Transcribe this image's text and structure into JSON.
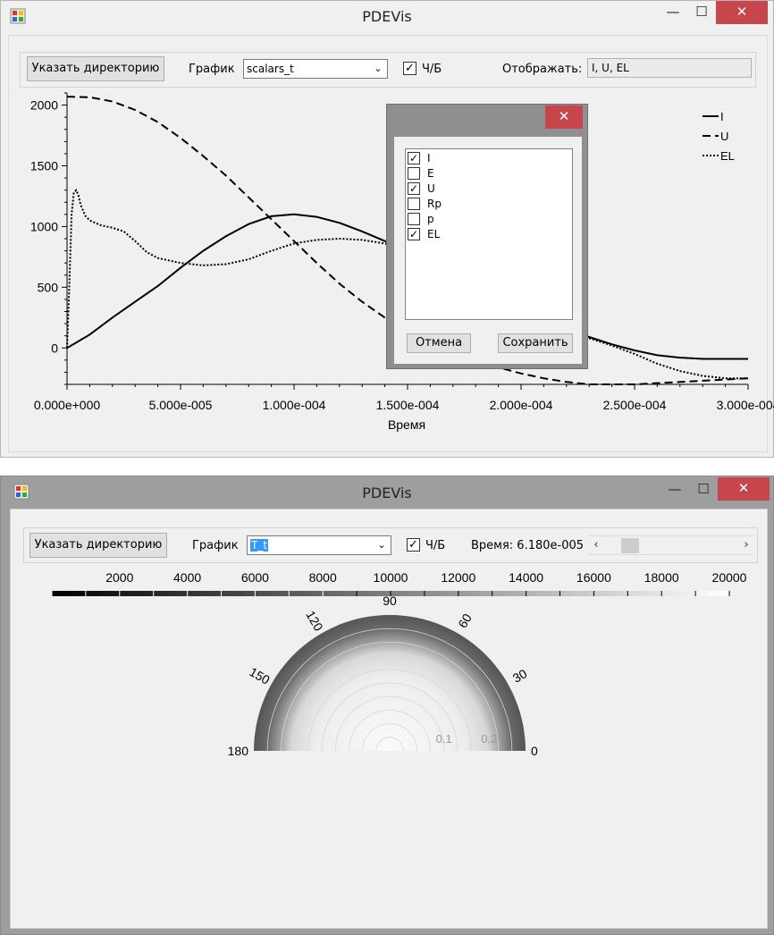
{
  "window1": {
    "title": "PDEVis",
    "controls": {
      "minimize": "—",
      "maximize": "☐",
      "close": "✕"
    },
    "toolbar": {
      "dir_button": "Указать директорию",
      "chart_label": "График",
      "chart_select": "scalars_t",
      "bw_checked": true,
      "bw_label": "Ч/Б",
      "display_label": "Отображать:",
      "display_value": "I, U, EL"
    },
    "legend": [
      {
        "name": "I",
        "style": "solid"
      },
      {
        "name": "U",
        "style": "dashed"
      },
      {
        "name": "EL",
        "style": "dotted"
      }
    ],
    "dialog": {
      "close": "✕",
      "items": [
        {
          "label": "I",
          "checked": true
        },
        {
          "label": "E",
          "checked": false
        },
        {
          "label": "U",
          "checked": true
        },
        {
          "label": "Rp",
          "checked": false
        },
        {
          "label": "p",
          "checked": false
        },
        {
          "label": "EL",
          "checked": true
        }
      ],
      "cancel": "Отмена",
      "save": "Сохранить"
    }
  },
  "chart_data": [
    {
      "type": "line",
      "xlabel": "Время",
      "ylabel": "",
      "xlim": [
        0,
        0.0003
      ],
      "ylim": [
        -300,
        2100
      ],
      "x_ticks": [
        "0.000e+000",
        "5.000e-005",
        "1.000e-004",
        "1.500e-004",
        "2.000e-004",
        "2.500e-004",
        "3.000e-004"
      ],
      "y_ticks": [
        "2000",
        "1500",
        "1000",
        "500",
        "0"
      ],
      "legend_position": "top-right",
      "series": [
        {
          "name": "I",
          "style": "solid",
          "x": [
            0,
            1e-05,
            2e-05,
            3e-05,
            4e-05,
            5e-05,
            6e-05,
            7e-05,
            8e-05,
            9e-05,
            0.0001,
            0.00011,
            0.00012,
            0.00013,
            0.00014,
            0.00015,
            0.00016,
            0.00017,
            0.00018,
            0.00019,
            0.0002,
            0.00021,
            0.00022,
            0.00023,
            0.00024,
            0.00025,
            0.00026,
            0.00027,
            0.00028,
            0.00029,
            0.0003
          ],
          "y": [
            0,
            110,
            250,
            380,
            510,
            660,
            800,
            920,
            1020,
            1085,
            1100,
            1080,
            1030,
            960,
            880,
            790,
            690,
            590,
            490,
            390,
            300,
            220,
            150,
            90,
            30,
            -20,
            -60,
            -80,
            -90,
            -90,
            -90
          ]
        },
        {
          "name": "U",
          "style": "dashed",
          "x": [
            0,
            1e-05,
            2e-05,
            3e-05,
            4e-05,
            5e-05,
            6e-05,
            7e-05,
            8e-05,
            9e-05,
            0.0001,
            0.00011,
            0.00012,
            0.00013,
            0.00014,
            0.00015,
            0.00016,
            0.00017,
            0.00018,
            0.00019,
            0.0002,
            0.00021,
            0.00022,
            0.00023,
            0.00024,
            0.00025,
            0.00026,
            0.00027,
            0.00028,
            0.00029,
            0.0003
          ],
          "y": [
            2070,
            2065,
            2030,
            1960,
            1860,
            1730,
            1580,
            1420,
            1240,
            1060,
            880,
            700,
            530,
            380,
            250,
            140,
            50,
            -30,
            -100,
            -160,
            -210,
            -250,
            -280,
            -300,
            -300,
            -300,
            -290,
            -280,
            -270,
            -260,
            -250
          ]
        },
        {
          "name": "EL",
          "style": "dotted",
          "x": [
            0,
            1e-06,
            2e-06,
            3e-06,
            4e-06,
            5e-06,
            6e-06,
            8e-06,
            1e-05,
            1.5e-05,
            2e-05,
            2.5e-05,
            3e-05,
            3.5e-05,
            4e-05,
            5e-05,
            6e-05,
            7e-05,
            8e-05,
            9e-05,
            0.0001,
            0.00011,
            0.00012,
            0.00013,
            0.00014,
            0.00015,
            0.00016,
            0.00017,
            0.00018,
            0.00019,
            0.0002,
            0.00021,
            0.00022,
            0.00023,
            0.00024,
            0.00025,
            0.00026,
            0.00027,
            0.00028,
            0.00029,
            0.0003
          ],
          "y": [
            0,
            500,
            1100,
            1280,
            1300,
            1260,
            1180,
            1090,
            1050,
            1010,
            990,
            960,
            880,
            790,
            740,
            700,
            680,
            690,
            730,
            800,
            860,
            890,
            900,
            890,
            860,
            800,
            720,
            630,
            530,
            420,
            320,
            230,
            150,
            80,
            20,
            -50,
            -130,
            -190,
            -230,
            -250,
            -250
          ]
        }
      ]
    },
    {
      "type": "heatmap",
      "subtype": "polar-semicircle",
      "colorbar_ticks": [
        "2000",
        "4000",
        "6000",
        "8000",
        "10000",
        "12000",
        "14000",
        "16000",
        "18000",
        "20000"
      ],
      "colorbar_range": [
        0,
        20000
      ],
      "colormap": "grayscale",
      "angle_ticks": [
        "0",
        "30",
        "60",
        "90",
        "120",
        "150",
        "180"
      ],
      "radial_ticks": [
        "0.1",
        "0.2"
      ],
      "radial_max": 0.3
    }
  ],
  "window2": {
    "title": "PDEVis",
    "controls": {
      "minimize": "—",
      "maximize": "☐",
      "close": "✕"
    },
    "toolbar": {
      "dir_button": "Указать директорию",
      "chart_label": "График",
      "chart_select": "T_t",
      "bw_checked": true,
      "bw_label": "Ч/Б",
      "time_label": "Время: 6.180e-005",
      "slider_left": "‹",
      "slider_right": "›",
      "slider_value": 0.15
    }
  }
}
